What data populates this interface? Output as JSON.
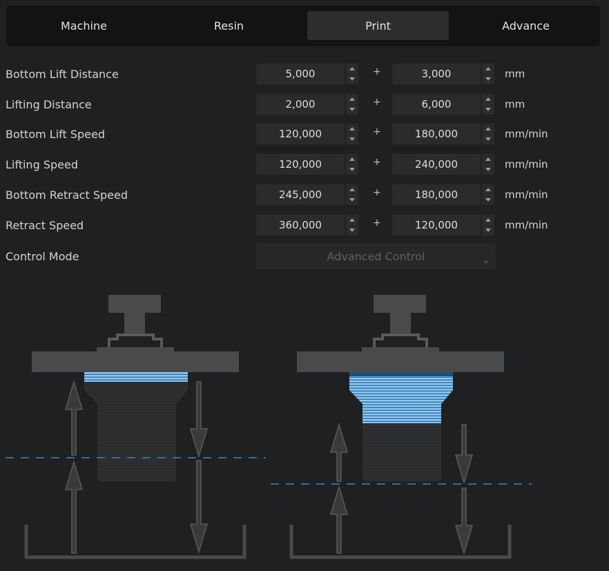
{
  "tabs": [
    {
      "label": "Machine",
      "active": false
    },
    {
      "label": "Resin",
      "active": false
    },
    {
      "label": "Print",
      "active": true
    },
    {
      "label": "Advance",
      "active": false
    }
  ],
  "params": [
    {
      "label": "Bottom Lift Distance",
      "value1": "5,000",
      "value2": "3,000",
      "unit": "mm"
    },
    {
      "label": "Lifting Distance",
      "value1": "2,000",
      "value2": "6,000",
      "unit": "mm"
    },
    {
      "label": "Bottom Lift Speed",
      "value1": "120,000",
      "value2": "180,000",
      "unit": "mm/min"
    },
    {
      "label": "Lifting Speed",
      "value1": "120,000",
      "value2": "240,000",
      "unit": "mm/min"
    },
    {
      "label": "Bottom Retract Speed",
      "value1": "245,000",
      "value2": "180,000",
      "unit": "mm/min"
    },
    {
      "label": "Retract Speed",
      "value1": "360,000",
      "value2": "120,000",
      "unit": "mm/min"
    }
  ],
  "plus_symbol": "+",
  "control_mode": {
    "label": "Control Mode",
    "value": "Advanced Control",
    "disabled": true
  },
  "colors": {
    "accent_blue": "#5aa7e6",
    "dark_blue": "#1d4f7a",
    "dashed_line": "#2f6fa8",
    "machine_gray": "#4a4a4b"
  },
  "icons": [
    "spin-up-icon",
    "spin-down-icon",
    "dropdown-caret-icon"
  ]
}
